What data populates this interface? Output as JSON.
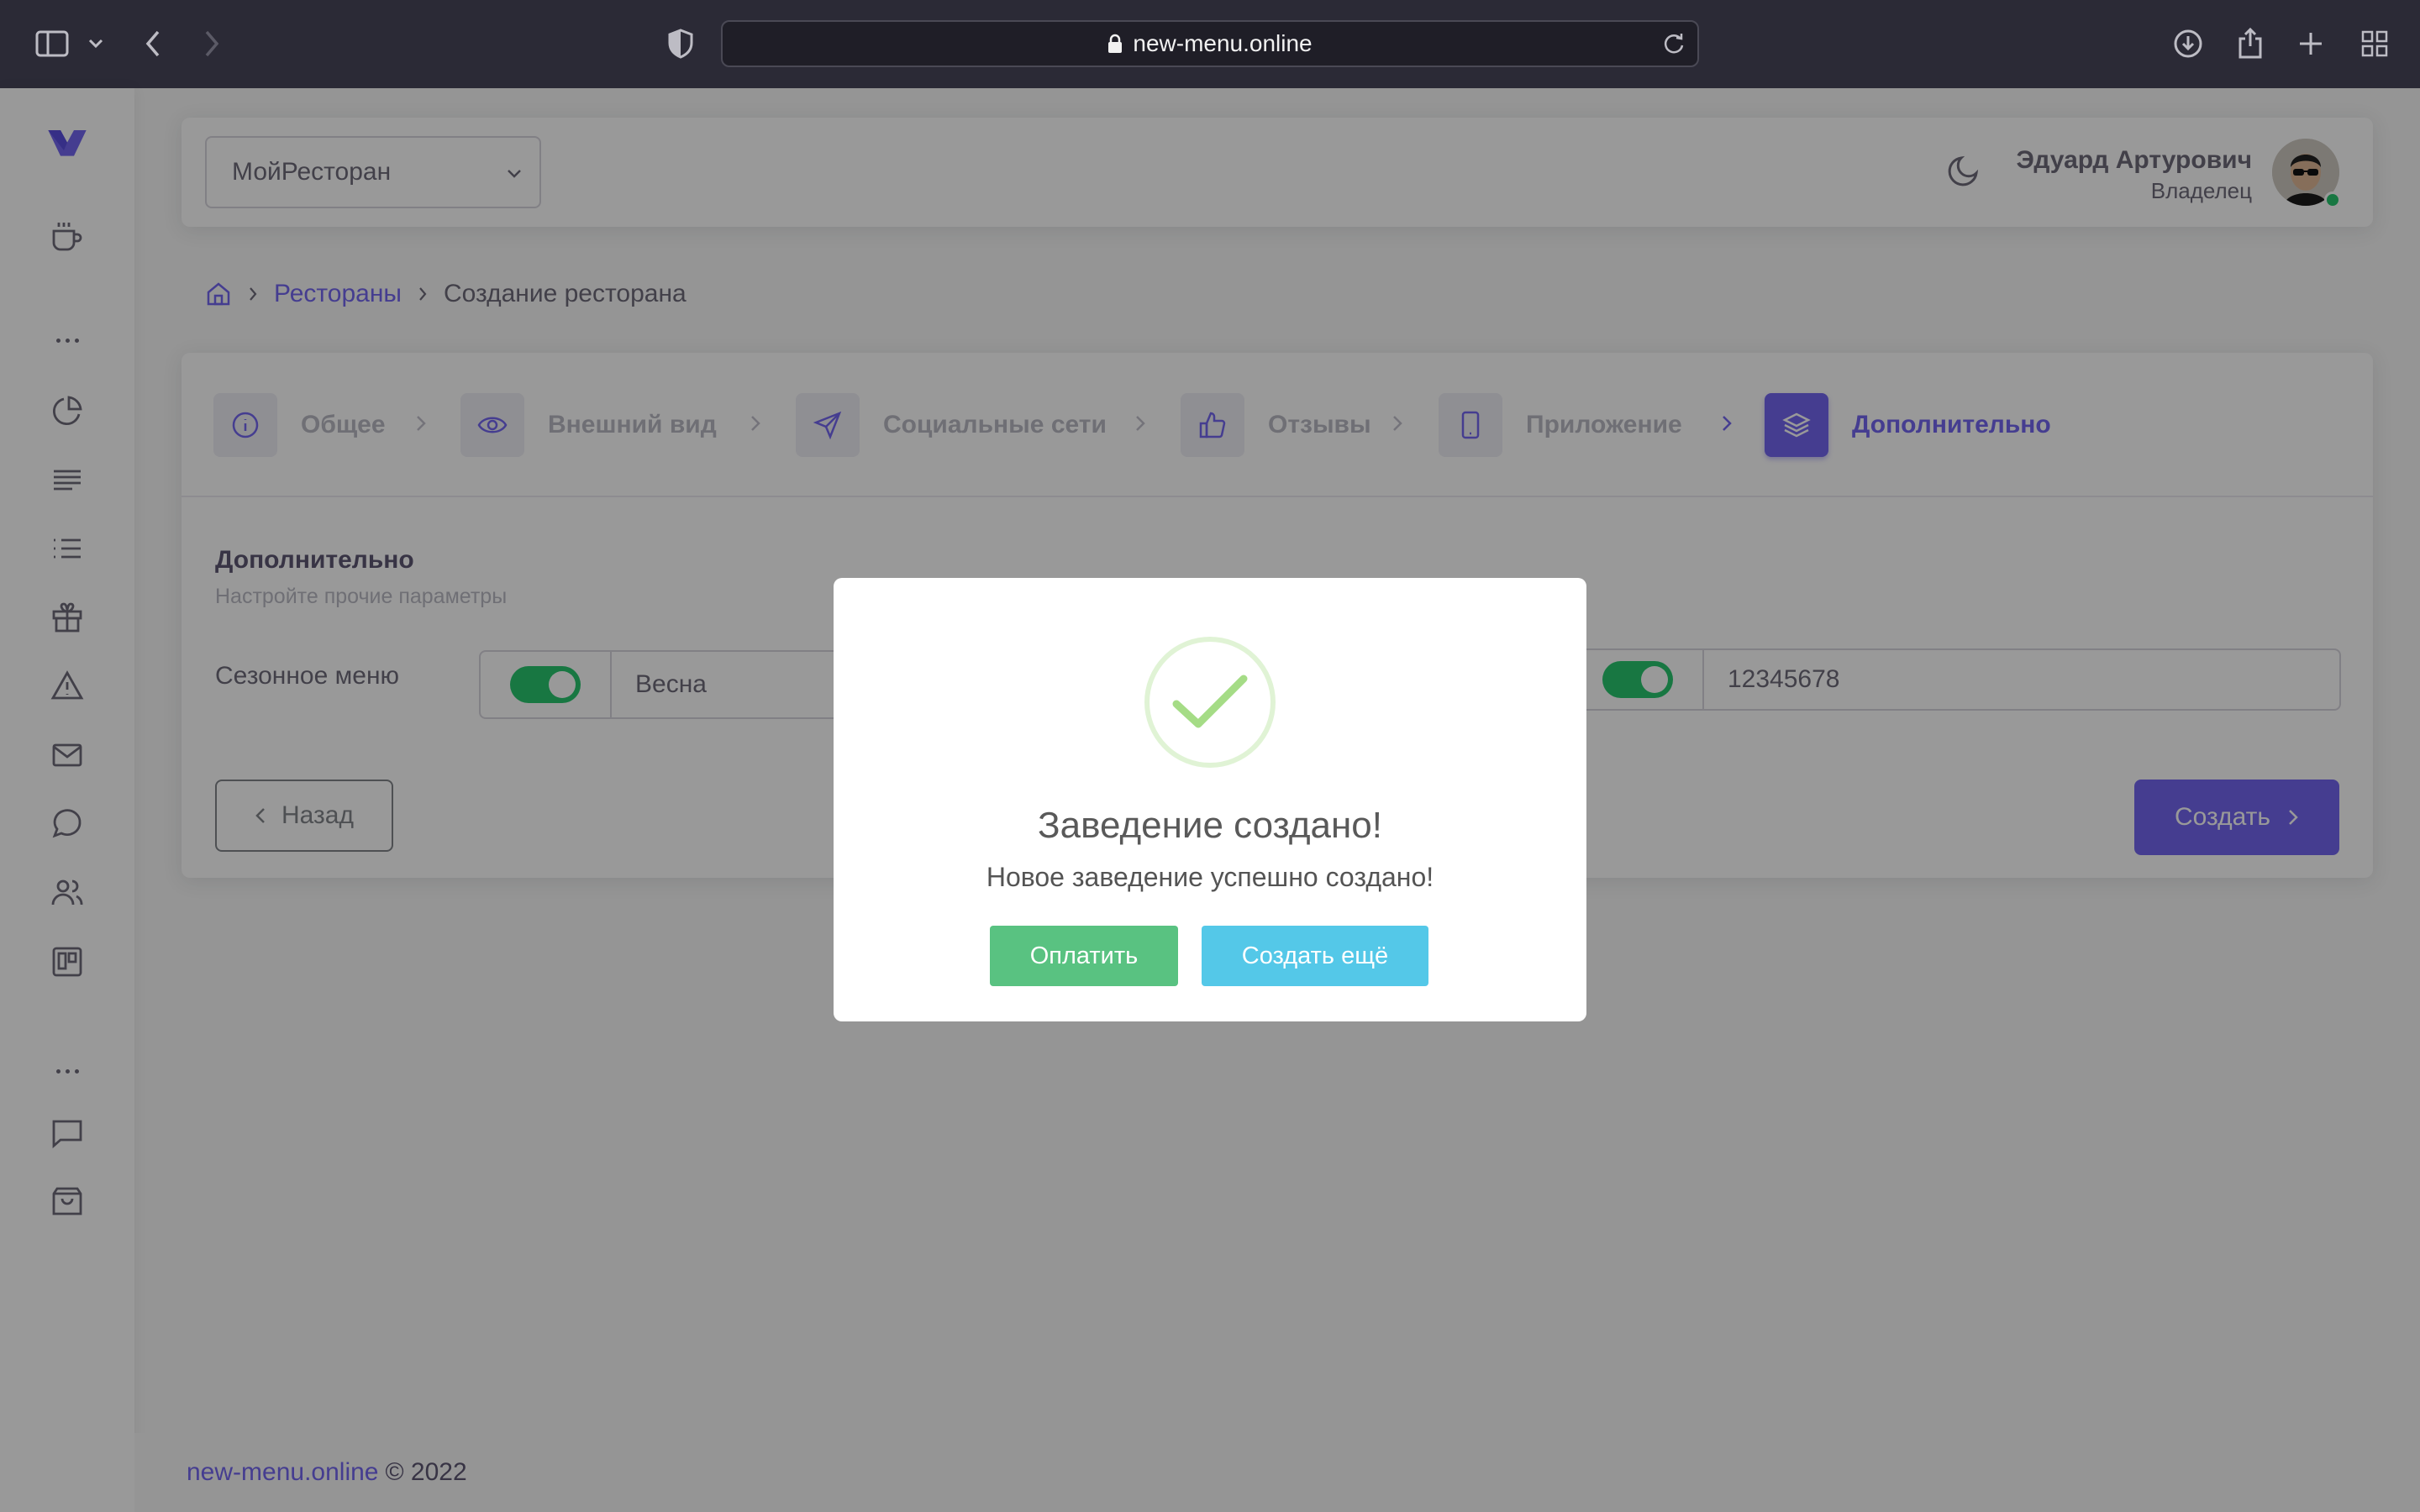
{
  "browser": {
    "url": "new-menu.online"
  },
  "navbar": {
    "restaurant_select": "МойРесторан",
    "user_name": "Эдуард Артурович",
    "user_role": "Владелец"
  },
  "breadcrumb": {
    "link": "Рестораны",
    "current": "Создание ресторана"
  },
  "steps": [
    {
      "label": "Общее"
    },
    {
      "label": "Внешний вид"
    },
    {
      "label": "Социальные сети"
    },
    {
      "label": "Отзывы"
    },
    {
      "label": "Приложение"
    },
    {
      "label": "Дополнительно"
    }
  ],
  "section": {
    "title": "Дополнительно",
    "subtitle": "Настройте прочие параметры",
    "seasonal_label": "Сезонное меню",
    "seasonal_value": "Весна",
    "second_value": "12345678"
  },
  "buttons": {
    "back": "Назад",
    "create": "Создать"
  },
  "modal": {
    "title": "Заведение создано!",
    "text": "Новое заведение успешно создано!",
    "pay": "Оплатить",
    "create_more": "Создать ещё"
  },
  "footer": {
    "link": "new-menu.online",
    "copyright": "© 2022"
  },
  "colors": {
    "primary": "#7367f0",
    "success": "#28c76f",
    "pay_button": "#59c281",
    "create_more_button": "#54c8e8"
  }
}
